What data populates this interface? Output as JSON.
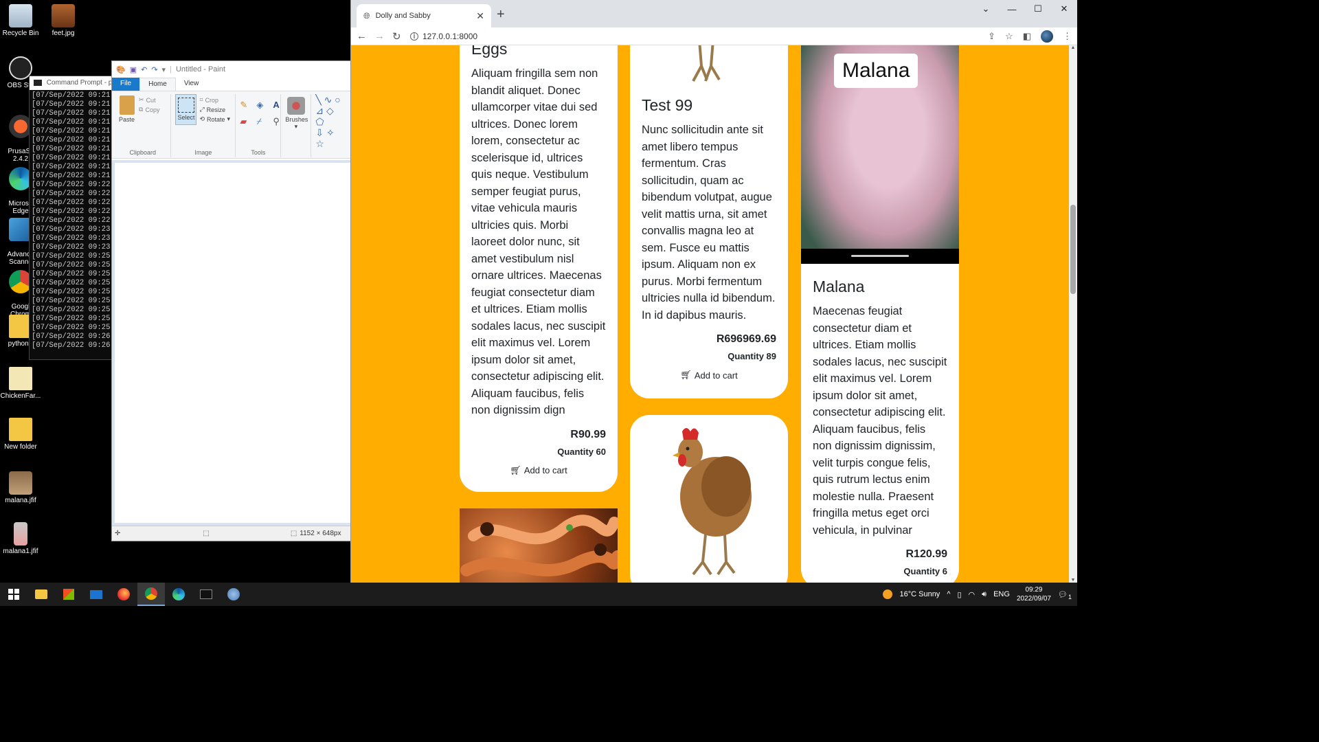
{
  "desktop": {
    "icons": [
      {
        "label": "Recycle Bin"
      },
      {
        "label": "feet.jpg"
      },
      {
        "label": "OBS Stu"
      },
      {
        "label": "PrusaSli\n2.4.2"
      },
      {
        "label": "Microso\nEdge"
      },
      {
        "label": "Advance\nScanne"
      },
      {
        "label": "Googl\nChrom"
      },
      {
        "label": "pythonE"
      },
      {
        "label": "ChickenFar..."
      },
      {
        "label": "New folder"
      },
      {
        "label": "malana.jfif"
      },
      {
        "label": "malana1.jfif"
      }
    ]
  },
  "cmd": {
    "title": "Command Prompt - p",
    "lines": [
      "[07/Sep/2022 09:21",
      "[07/Sep/2022 09:21",
      "[07/Sep/2022 09:21",
      "[07/Sep/2022 09:21",
      "[07/Sep/2022 09:21",
      "[07/Sep/2022 09:21",
      "[07/Sep/2022 09:21",
      "[07/Sep/2022 09:21",
      "[07/Sep/2022 09:21",
      "[07/Sep/2022 09:21",
      "[07/Sep/2022 09:22",
      "[07/Sep/2022 09:22",
      "[07/Sep/2022 09:22",
      "[07/Sep/2022 09:22",
      "[07/Sep/2022 09:22",
      "[07/Sep/2022 09:23",
      "[07/Sep/2022 09:23",
      "[07/Sep/2022 09:23",
      "[07/Sep/2022 09:25",
      "[07/Sep/2022 09:25",
      "[07/Sep/2022 09:25",
      "[07/Sep/2022 09:25",
      "[07/Sep/2022 09:25",
      "[07/Sep/2022 09:25",
      "[07/Sep/2022 09:25",
      "[07/Sep/2022 09:25",
      "[07/Sep/2022 09:25",
      "[07/Sep/2022 09:26",
      "[07/Sep/2022 09:26"
    ]
  },
  "paint": {
    "title": "Untitled - Paint",
    "tabs": {
      "file": "File",
      "home": "Home",
      "view": "View"
    },
    "clipboard": {
      "paste": "Paste",
      "cut": "Cut",
      "copy": "Copy",
      "group": "Clipboard"
    },
    "image": {
      "select": "Select",
      "crop": "Crop",
      "resize": "Resize",
      "rotate": "Rotate",
      "group": "Image"
    },
    "tools": {
      "group": "Tools"
    },
    "brushes": "Brushes",
    "status": {
      "size": "1152 × 648px"
    }
  },
  "browser": {
    "tab_title": "Dolly and Sabby",
    "url": "127.0.0.1:8000"
  },
  "products": {
    "eggs": {
      "name": "Eggs",
      "description": "Aliquam fringilla sem non blandit aliquet. Donec ullamcorper vitae dui sed ultrices. Donec lorem lorem, consectetur ac scelerisque id, ultrices quis neque. Vestibulum semper feugiat purus, vitae vehicula mauris ultricies quis. Morbi laoreet dolor nunc, sit amet vestibulum nisl ornare ultrices. Maecenas feugiat consectetur diam et ultrices. Etiam mollis sodales lacus, nec suscipit elit maximus vel. Lorem ipsum dolor sit amet, consectetur adipiscing elit. Aliquam faucibus, felis non dignissim dign",
      "price": "R90.99",
      "quantity": "Quantity 60",
      "add_to_cart": "Add to cart"
    },
    "test99": {
      "name": "Test 99",
      "description": "Nunc sollicitudin ante sit amet libero tempus fermentum. Cras sollicitudin, quam ac bibendum volutpat, augue velit mattis urna, sit amet convallis magna leo at sem. Fusce eu mattis ipsum. Aliquam non ex purus. Morbi fermentum ultricies nulla id bibendum. In id dapibus mauris.",
      "price": "R696969.69",
      "quantity": "Quantity 89",
      "add_to_cart": "Add to cart"
    },
    "malana": {
      "name": "Malana",
      "image_caption": "Malana",
      "description": "Maecenas feugiat consectetur diam et ultrices. Etiam mollis sodales lacus, nec suscipit elit maximus vel. Lorem ipsum dolor sit amet, consectetur adipiscing elit. Aliquam faucibus, felis non dignissim dignissim, velit turpis congue felis, quis rutrum lectus enim molestie nulla. Praesent fringilla metus eget orci vehicula, in pulvinar",
      "price": "R120.99",
      "quantity": "Quantity 6"
    }
  },
  "taskbar": {
    "weather": "16°C  Sunny",
    "lang": "ENG",
    "time": "09:29",
    "date": "2022/09/07",
    "notifications": "1"
  },
  "colors": {
    "page_bg": "#ffad00",
    "paint_file_tab": "#1979ca"
  }
}
